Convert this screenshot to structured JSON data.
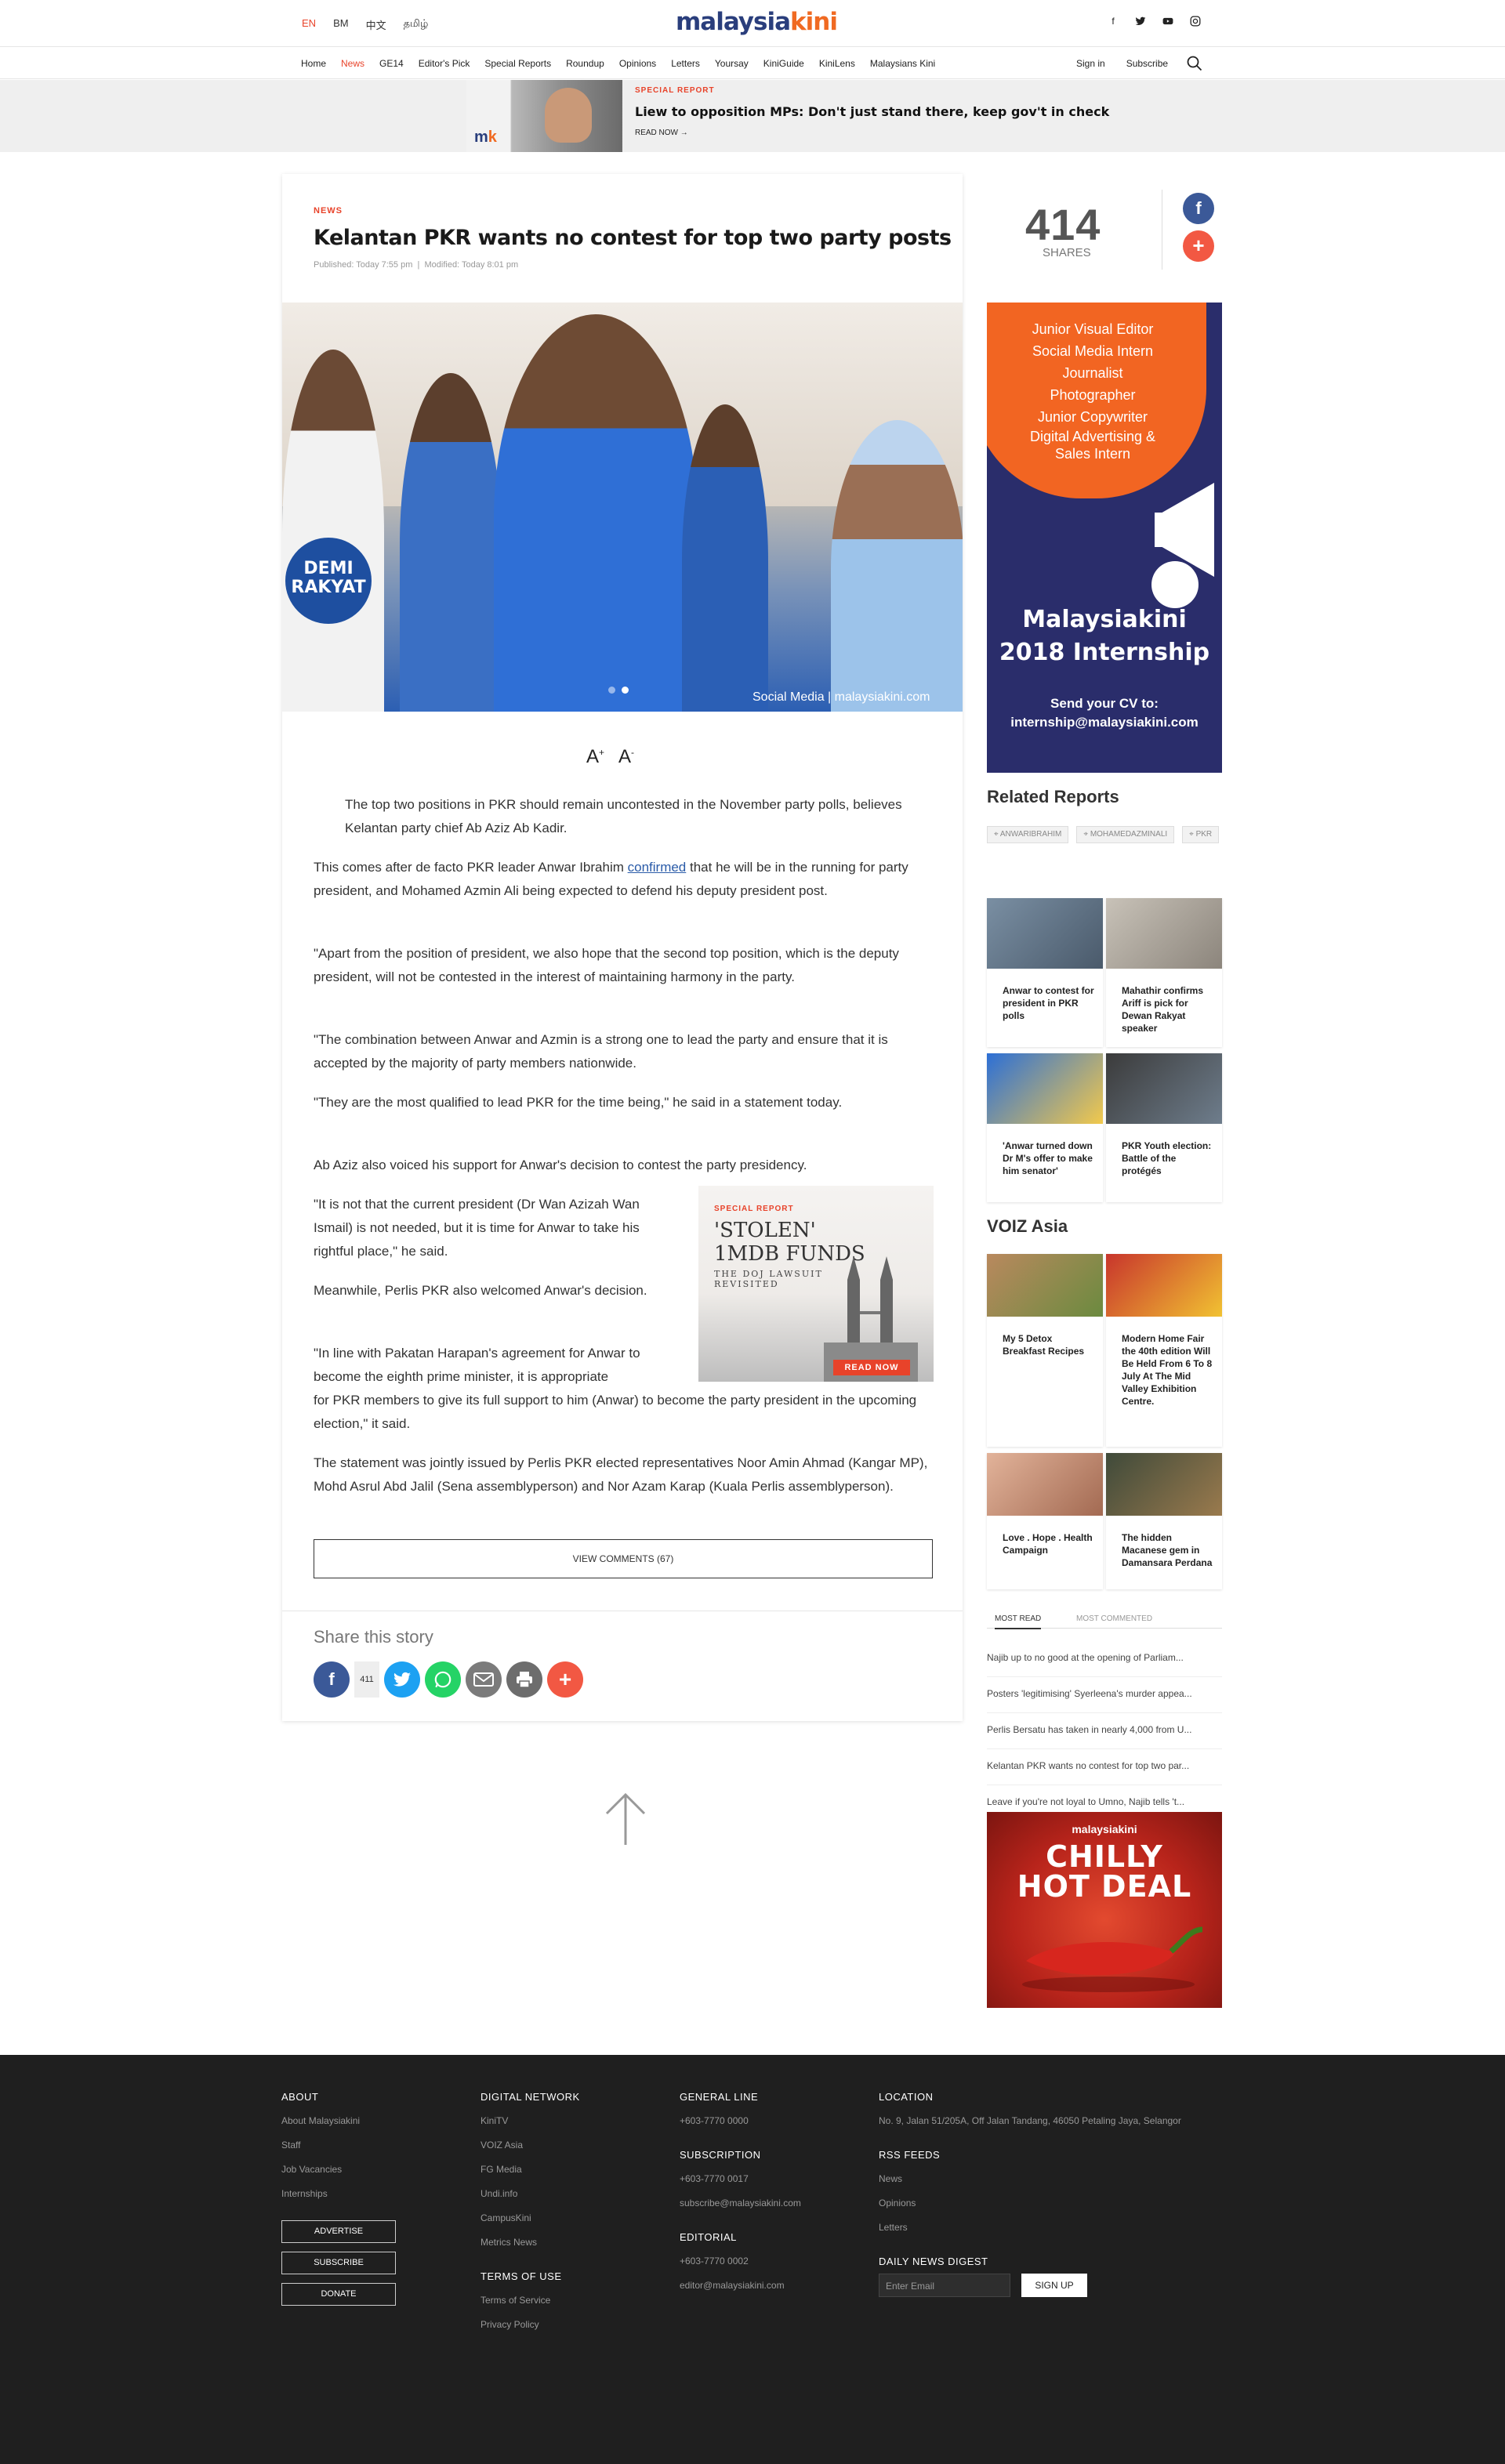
{
  "header": {
    "langs": [
      "EN",
      "BM",
      "中文",
      "தமிழ்"
    ],
    "logo_main": "malaysia",
    "logo_accent": "kini",
    "social": [
      "f",
      "t",
      "▶",
      "◎"
    ]
  },
  "nav": {
    "items": [
      "Home",
      "News",
      "GE14",
      "Editor's Pick",
      "Special Reports",
      "Roundup",
      "Opinions",
      "Letters",
      "Yoursay",
      "KiniGuide",
      "KiniLens",
      "Malaysians Kini"
    ],
    "signin": "Sign in",
    "subscribe": "Subscribe"
  },
  "special_report": {
    "kicker": "SPECIAL REPORT",
    "title": "Liew to opposition MPs: Don't just stand there, keep gov't in check",
    "read": "READ NOW →"
  },
  "article": {
    "kicker": "NEWS",
    "title": "Kelantan PKR wants no contest for top two party posts",
    "published": "Published: Today 7:55 pm",
    "modified": "Modified: Today 8:01 pm",
    "photo_credit": "Social Media | malaysiakini.com",
    "font_up": "A",
    "font_down": "A",
    "lead": "The top two positions in PKR should remain uncontested in the November party polls, believes Kelantan party chief Ab Aziz Ab Kadir.",
    "p1a": "This comes after de facto PKR leader Anwar Ibrahim ",
    "p1link": "confirmed",
    "p1b": " that he will be in the running for party president, and Mohamed Azmin Ali being expected to defend his deputy president post.",
    "p2": "\"Apart from the position of president, we also hope that the second top position, which is the deputy president, will not be contested in the interest of maintaining harmony in the party.",
    "p3": "\"The combination between Anwar and Azmin is a strong one to lead the party and ensure that it is accepted by the majority of party members nationwide.",
    "p4": "\"They are the most qualified to lead PKR for the time being,\" he said in a statement today.",
    "p5": "Ab Aziz also voiced his support for Anwar's decision to contest the party presidency.",
    "p6": "\"It is not that the current president (Dr Wan Azizah Wan Ismail) is not needed, but it is time for Anwar to take his rightful place,\" he said.",
    "p7": "Meanwhile, Perlis PKR also welcomed Anwar's decision.",
    "p8a": "\"In line with Pakatan Harapan's agreement for Anwar to become the eighth prime minister, it is appropriate",
    "p8b": "for PKR members to give its full support to him (Anwar) to become the party president in the upcoming election,\" it said.",
    "p9": "The statement was jointly issued by Perlis PKR elected representatives Noor Amin Ahmad (Kangar MP), Mohd Asrul Abd Jalil (Sena assemblyperson) and Nor Azam Karap (Kuala Perlis assemblyperson).",
    "view_comments": "VIEW COMMENTS (67)",
    "share_label": "Share this story",
    "share_count": "411"
  },
  "inline_ad": {
    "kicker": "SPECIAL REPORT",
    "title_l1": "'STOLEN'",
    "title_l2": "1MDB FUNDS",
    "sub_l1": "THE DOJ LAWSUIT",
    "sub_l2": "REVISITED",
    "cta": "READ NOW"
  },
  "sidebar": {
    "shares": "414",
    "shares_label": "SHARES",
    "intern_roles": [
      "Junior Visual Editor",
      "Social Media Intern",
      "Journalist",
      "Photographer",
      "Junior Copywriter",
      "Digital Advertising &",
      "Sales Intern"
    ],
    "intern_brand_l1": "Malaysiakini",
    "intern_brand_l2": "2018 Internship",
    "intern_cv_l1": "Send your CV to:",
    "intern_cv_l2": "internship@malaysiakini.com",
    "related_heading": "Related Reports",
    "tags": [
      "ANWARIBRAHIM",
      "MOHAMEDAZMINALI",
      "PKR"
    ],
    "related": [
      "Anwar to contest for president in PKR polls",
      "Mahathir confirms Ariff is pick for Dewan Rakyat speaker",
      "'Anwar turned down Dr M's offer to make him senator'",
      "PKR Youth election: Battle of the protégés"
    ],
    "voiz_heading": "VOIZ Asia",
    "voiz": [
      "My 5 Detox Breakfast Recipes",
      "Modern Home Fair the 40th edition Will Be Held From 6 To 8 July At The Mid Valley Exhibition Centre.",
      "Love . Hope . Health Campaign",
      "The hidden Macanese gem in Damansara Perdana"
    ],
    "tab_most_read": "MOST READ",
    "tab_most_commented": "MOST COMMENTED",
    "most_read": [
      "Najib up to no good at the opening of Parliam...",
      "Posters 'legitimising' Syerleena's murder appea...",
      "Perlis Bersatu has taken in nearly 4,000 from U...",
      "Kelantan PKR wants no contest for top two par...",
      "Leave if you're not loyal to Umno, Najib tells 't..."
    ],
    "chilly_brand": "malaysiakini",
    "chilly_l1": "CHILLY",
    "chilly_l2": "HOT DEAL"
  },
  "footer": {
    "about_h": "ABOUT",
    "about": [
      "About Malaysiakini",
      "Staff",
      "Job Vacancies",
      "Internships"
    ],
    "buttons": [
      "ADVERTISE",
      "SUBSCRIBE",
      "DONATE"
    ],
    "network_h": "DIGITAL NETWORK",
    "network": [
      "KiniTV",
      "VOIZ Asia",
      "FG Media",
      "Undi.info",
      "CampusKini",
      "Metrics News"
    ],
    "terms_h": "TERMS OF USE",
    "terms": [
      "Terms of Service",
      "Privacy Policy"
    ],
    "general_h": "GENERAL LINE",
    "general": "+603-7770 0000",
    "subs_h": "SUBSCRIPTION",
    "subs_phone": "+603-7770 0017",
    "subs_email": "subscribe@malaysiakini.com",
    "edit_h": "EDITORIAL",
    "edit_phone": "+603-7770 0002",
    "edit_email": "editor@malaysiakini.com",
    "loc_h": "LOCATION",
    "loc": "No. 9, Jalan 51/205A, Off Jalan Tandang, 46050 Petaling Jaya, Selangor",
    "rss_h": "RSS FEEDS",
    "rss": [
      "News",
      "Opinions",
      "Letters"
    ],
    "digest_h": "DAILY NEWS DIGEST",
    "email_placeholder": "Enter Email",
    "signup": "SIGN UP"
  }
}
